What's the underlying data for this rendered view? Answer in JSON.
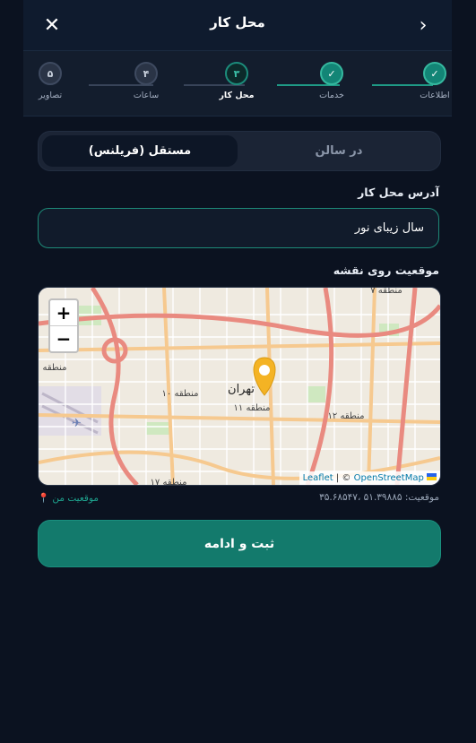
{
  "header": {
    "title": "محل کار"
  },
  "steps": [
    {
      "num": "✓",
      "label": "اطلاعات",
      "state": "done"
    },
    {
      "num": "✓",
      "label": "خدمات",
      "state": "done"
    },
    {
      "num": "۳",
      "label": "محل کار",
      "state": "current"
    },
    {
      "num": "۴",
      "label": "ساعات",
      "state": "todo"
    },
    {
      "num": "۵",
      "label": "تصاویر",
      "state": "todo"
    }
  ],
  "location_type": {
    "selected": "مستقل (فریلنس)",
    "other": "در سالن"
  },
  "address": {
    "label": "آدرس محل کار",
    "value": "سال زیبای نور"
  },
  "map": {
    "label": "موقعیت روی نقشه",
    "city_label": "تهران",
    "region_labels": [
      "منطقه ۱۰",
      "منطقه ۱۱",
      "منطقه ۱۲",
      "منطقه ۷",
      "منطقه",
      "منطقه ۱۷"
    ],
    "zoom_in": "+",
    "zoom_out": "−",
    "attribution_leaflet": "Leaflet",
    "attribution_sep": "| ©",
    "attribution_osm": "OpenStreetMap",
    "marker_color": "#f4b324"
  },
  "coordinates": "موقعیت: ۵۱.۳۹۸۸۵ ،۳۵.۶۸۵۴۷",
  "my_location": "موقعیت من",
  "submit_label": "ثبت و ادامه",
  "colors": {
    "accent": "#137a6c",
    "background": "#0b1220"
  }
}
